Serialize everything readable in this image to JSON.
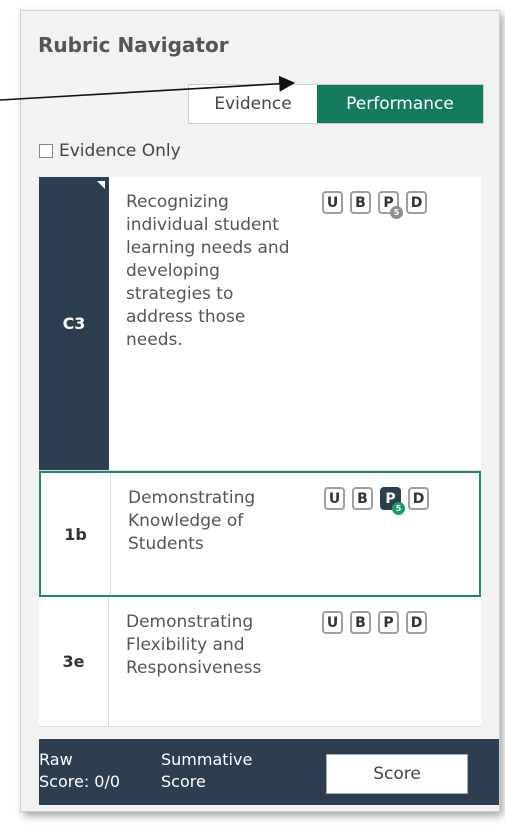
{
  "title": "Rubric Navigator",
  "toggle": {
    "evidence_label": "Evidence",
    "performance_label": "Performance",
    "active": "Performance"
  },
  "evidence_only": {
    "label": "Evidence Only",
    "checked": false
  },
  "rows": [
    {
      "code": "C3",
      "description": "Recognizing individual student learning needs and developing strategies to address those needs.",
      "scores": [
        "U",
        "B",
        "P",
        "D"
      ],
      "badge": {
        "on": "P",
        "count": "5"
      }
    },
    {
      "code": "1b",
      "description": "Demonstrating Knowledge of Students",
      "scores": [
        "U",
        "B",
        "P",
        "D"
      ],
      "badge": {
        "on": "P",
        "count": "5"
      },
      "selected_score": "P"
    },
    {
      "code": "3e",
      "description": "Demonstrating Flexibility and Responsiveness",
      "scores": [
        "U",
        "B",
        "P",
        "D"
      ]
    }
  ],
  "footer": {
    "raw_label": "Raw",
    "raw_value": "Score: 0/0",
    "summative_line1": "Summative",
    "summative_line2": "Score",
    "score_button": "Score"
  },
  "colors": {
    "accent": "#137a5b",
    "dark": "#2d3e50"
  }
}
